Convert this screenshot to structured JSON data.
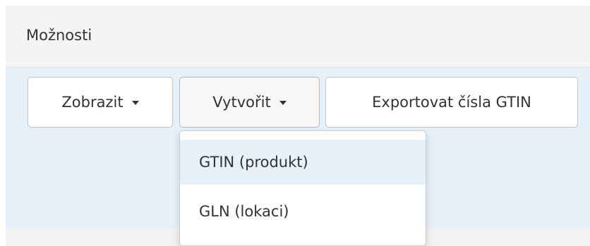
{
  "panel": {
    "title": "Možnosti"
  },
  "toolbar": {
    "show_label": "Zobrazit",
    "create_label": "Vytvořit",
    "export_label": "Exportovat čísla GTIN"
  },
  "create_menu": {
    "items": [
      {
        "label": "GTIN (produkt)",
        "highlighted": true
      },
      {
        "label": "GLN (lokaci)",
        "highlighted": false
      }
    ]
  },
  "icons": {
    "dropdown_caret": "caret-down-icon"
  },
  "colors": {
    "header_bg": "#f4f4f4",
    "body_bg": "#e5f0f8",
    "highlight": "#e6f1fa",
    "text": "#333333"
  }
}
